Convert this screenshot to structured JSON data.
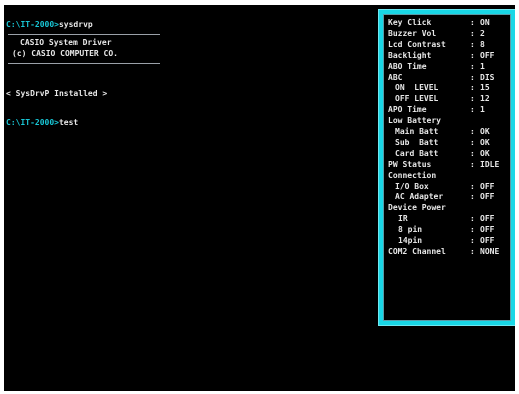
{
  "console": {
    "prompt": "C:\\IT-2000>",
    "cmd1": "sysdrvp",
    "banner1": "CASIO System Driver",
    "banner2": "(c) CASIO COMPUTER CO.",
    "installed": "< SysDrvP Installed >",
    "cmd2": "test"
  },
  "panel": {
    "colon": ":",
    "rows": [
      {
        "label": "Key Click",
        "value": "ON",
        "indent": 0
      },
      {
        "label": "Buzzer Vol",
        "value": "2",
        "indent": 0
      },
      {
        "label": "Lcd Contrast",
        "value": "8",
        "indent": 0
      },
      {
        "label": "Backlight",
        "value": "OFF",
        "indent": 0
      },
      {
        "label": "ABO Time",
        "value": "1",
        "indent": 0
      },
      {
        "label": "ABC",
        "value": "DIS",
        "indent": 0
      },
      {
        "label": "ON  LEVEL",
        "value": "15",
        "indent": 1
      },
      {
        "label": "OFF LEVEL",
        "value": "12",
        "indent": 1
      },
      {
        "label": "APO Time",
        "value": "1",
        "indent": 0
      },
      {
        "label": "Low Battery",
        "value": "",
        "indent": 0
      },
      {
        "label": "Main Batt",
        "value": "OK",
        "indent": 1
      },
      {
        "label": "Sub  Batt",
        "value": "OK",
        "indent": 1
      },
      {
        "label": "Card Batt",
        "value": "OK",
        "indent": 1
      },
      {
        "label": "PW Status",
        "value": "IDLE",
        "indent": 0
      },
      {
        "label": "Connection",
        "value": "",
        "indent": 0
      },
      {
        "label": "I/O Box",
        "value": "OFF",
        "indent": 1
      },
      {
        "label": "AC Adapter",
        "value": "OFF",
        "indent": 1
      },
      {
        "label": "Device Power",
        "value": "",
        "indent": 0
      },
      {
        "label": "IR",
        "value": "OFF",
        "indent": 2
      },
      {
        "label": "8 pin",
        "value": "OFF",
        "indent": 2
      },
      {
        "label": "14pin",
        "value": "OFF",
        "indent": 2
      },
      {
        "label": "COM2 Channel",
        "value": "NONE",
        "indent": 0
      }
    ]
  },
  "colors": {
    "background": "#000000",
    "text": "#e8e8e8",
    "prompt": "#18c7d6",
    "panel_border": "#19d7e6"
  }
}
